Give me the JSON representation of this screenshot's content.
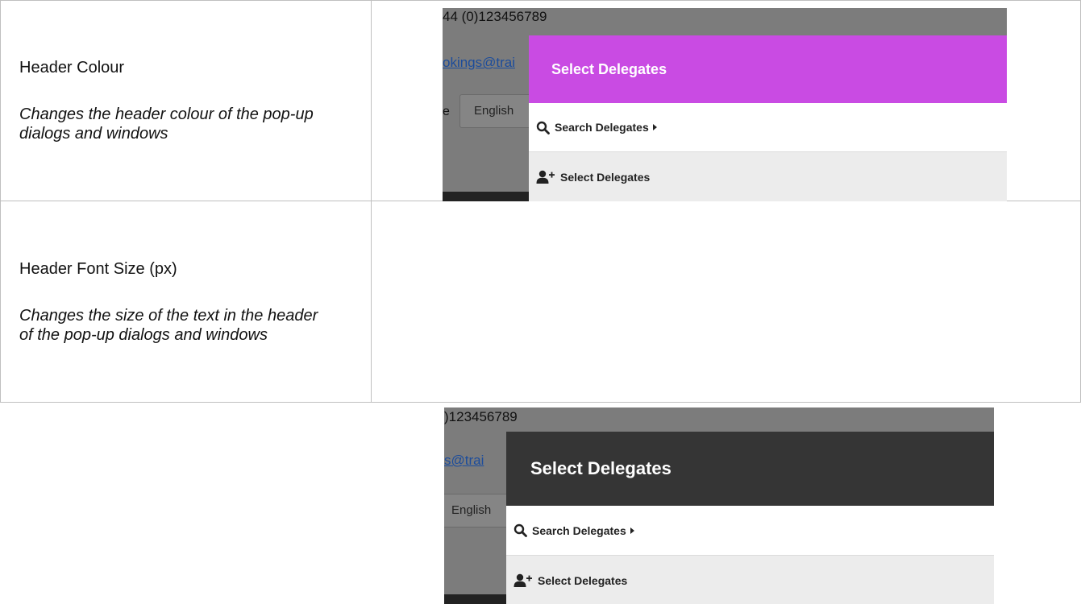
{
  "rows": [
    {
      "title": "Header Colour",
      "description": "Changes the header colour of the pop-up dialogs and windows",
      "screenshot": {
        "phone": "44 (0)123456789",
        "email_fragment": "okings@trai",
        "language_prefix": "e",
        "language": "English",
        "modal_title": "Select Delegates",
        "search_label": "Search Delegates",
        "select_label": "Select Delegates",
        "header_color": "#c94be3"
      }
    },
    {
      "title": "Header Font Size (px)",
      "description": "Changes the size of the text in the header of the pop-up dialogs and windows",
      "screenshot": {
        "phone": ")123456789",
        "email_fragment": "s@trai",
        "language": "English",
        "modal_title": "Select Delegates",
        "search_label": "Search Delegates",
        "select_label": "Select Delegates",
        "header_color": "#353535"
      }
    }
  ]
}
